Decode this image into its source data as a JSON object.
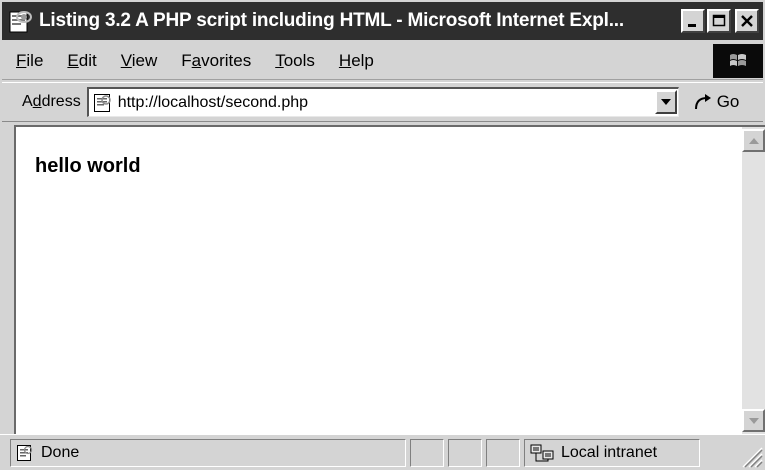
{
  "window": {
    "title": "Listing 3.2 A PHP script including HTML - Microsoft Internet Expl...",
    "minimize_label": "minimize",
    "maximize_label": "maximize",
    "close_label": "close"
  },
  "menubar": {
    "items": [
      {
        "label": "File",
        "access_key": "F"
      },
      {
        "label": "Edit",
        "access_key": "E"
      },
      {
        "label": "View",
        "access_key": "V"
      },
      {
        "label": "Favorites",
        "access_key": "a"
      },
      {
        "label": "Tools",
        "access_key": "T"
      },
      {
        "label": "Help",
        "access_key": "H"
      }
    ]
  },
  "addressbar": {
    "label": "Address",
    "url": "http://localhost/second.php",
    "go_label": "Go"
  },
  "page": {
    "heading": "hello world"
  },
  "statusbar": {
    "status": "Done",
    "zone": "Local intranet"
  },
  "icons": {
    "title": "ie-page-icon",
    "throbber": "windows-logo-icon",
    "address": "page-icon",
    "go": "go-arrow-icon",
    "status": "page-done-icon",
    "zone": "local-intranet-icon"
  },
  "colors": {
    "titlebar": "#2e2e2e",
    "chrome": "#d4d4d4",
    "content": "#ffffff"
  }
}
